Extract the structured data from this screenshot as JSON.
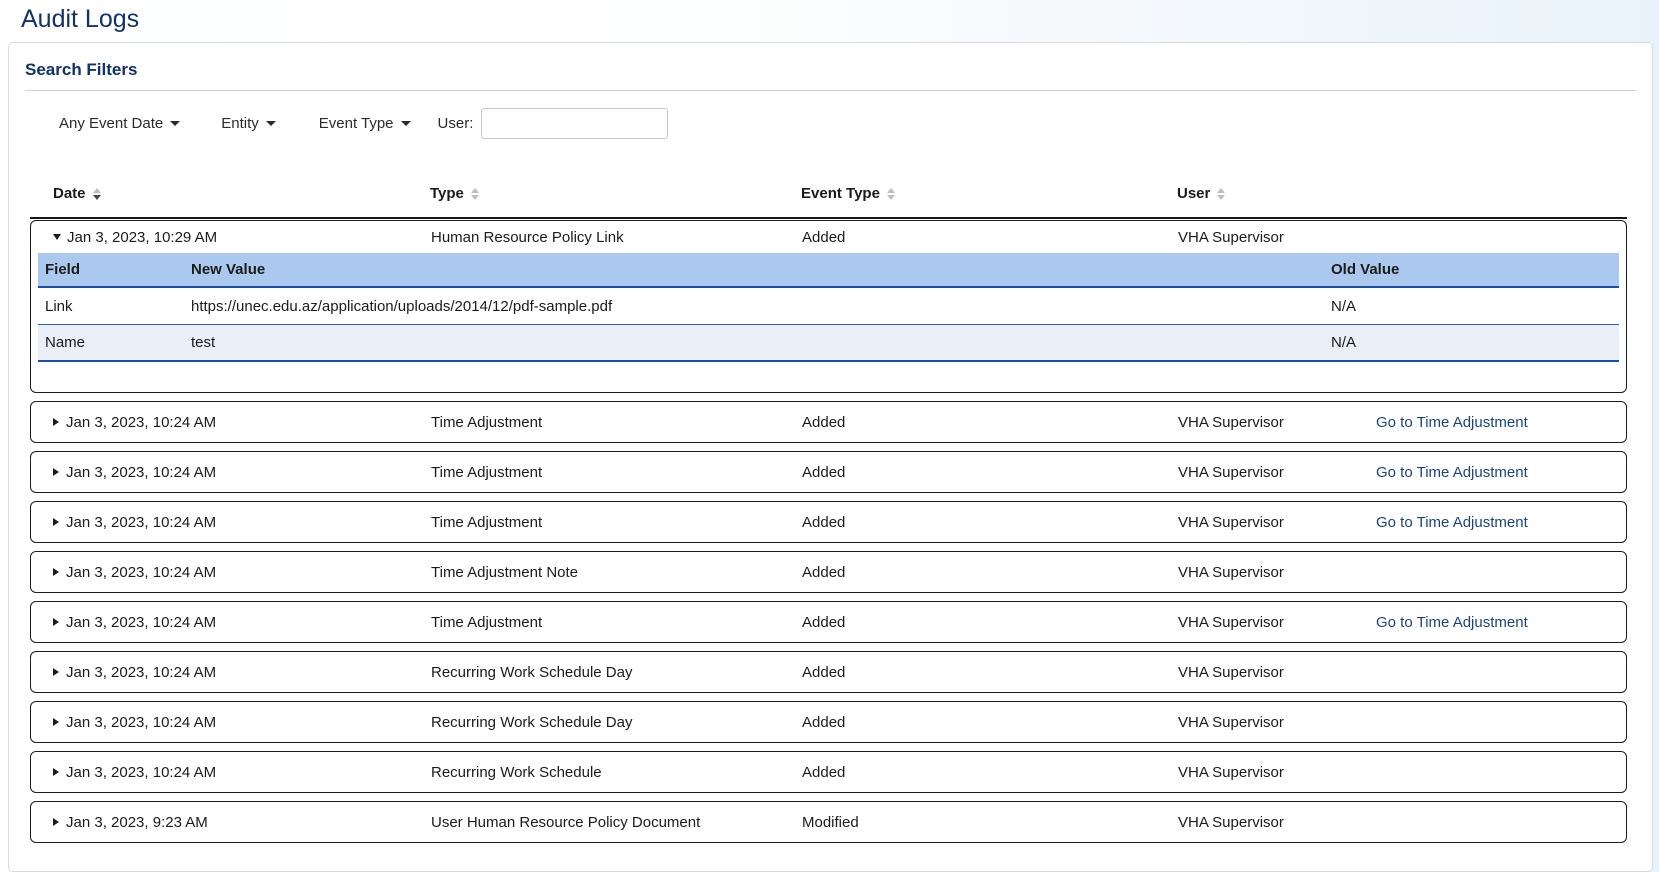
{
  "page": {
    "title": "Audit Logs"
  },
  "filters": {
    "heading": "Search Filters",
    "dropdowns": [
      {
        "label": "Any Event Date"
      },
      {
        "label": "Entity"
      },
      {
        "label": "Event Type"
      }
    ],
    "user": {
      "label": "User:",
      "value": "",
      "placeholder": ""
    }
  },
  "table": {
    "columns": [
      {
        "label": "Date",
        "sort_state": "desc"
      },
      {
        "label": "Type",
        "sort_state": "none"
      },
      {
        "label": "Event Type",
        "sort_state": "none"
      },
      {
        "label": "User",
        "sort_state": "none"
      }
    ],
    "rows": [
      {
        "date": "Jan 3, 2023, 10:29 AM",
        "type": "Human Resource Policy Link",
        "event_type": "Added",
        "user": "VHA Supervisor",
        "action": "",
        "expanded": true,
        "details": {
          "columns": [
            "Field",
            "New Value",
            "Old Value"
          ],
          "rows": [
            {
              "field": "Link",
              "new_value": "https://unec.edu.az/application/uploads/2014/12/pdf-sample.pdf",
              "old_value": "N/A"
            },
            {
              "field": "Name",
              "new_value": "test",
              "old_value": "N/A"
            }
          ]
        }
      },
      {
        "date": "Jan 3, 2023, 10:24 AM",
        "type": "Time Adjustment",
        "event_type": "Added",
        "user": "VHA Supervisor",
        "action": "Go to Time Adjustment",
        "expanded": false
      },
      {
        "date": "Jan 3, 2023, 10:24 AM",
        "type": "Time Adjustment",
        "event_type": "Added",
        "user": "VHA Supervisor",
        "action": "Go to Time Adjustment",
        "expanded": false
      },
      {
        "date": "Jan 3, 2023, 10:24 AM",
        "type": "Time Adjustment",
        "event_type": "Added",
        "user": "VHA Supervisor",
        "action": "Go to Time Adjustment",
        "expanded": false
      },
      {
        "date": "Jan 3, 2023, 10:24 AM",
        "type": "Time Adjustment Note",
        "event_type": "Added",
        "user": "VHA Supervisor",
        "action": "",
        "expanded": false
      },
      {
        "date": "Jan 3, 2023, 10:24 AM",
        "type": "Time Adjustment",
        "event_type": "Added",
        "user": "VHA Supervisor",
        "action": "Go to Time Adjustment",
        "expanded": false
      },
      {
        "date": "Jan 3, 2023, 10:24 AM",
        "type": "Recurring Work Schedule Day",
        "event_type": "Added",
        "user": "VHA Supervisor",
        "action": "",
        "expanded": false
      },
      {
        "date": "Jan 3, 2023, 10:24 AM",
        "type": "Recurring Work Schedule Day",
        "event_type": "Added",
        "user": "VHA Supervisor",
        "action": "",
        "expanded": false
      },
      {
        "date": "Jan 3, 2023, 10:24 AM",
        "type": "Recurring Work Schedule",
        "event_type": "Added",
        "user": "VHA Supervisor",
        "action": "",
        "expanded": false
      },
      {
        "date": "Jan 3, 2023, 9:23 AM",
        "type": "User Human Resource Policy Document",
        "event_type": "Modified",
        "user": "VHA Supervisor",
        "action": "",
        "expanded": false
      }
    ]
  },
  "colors": {
    "heading_navy": "#13316d",
    "link_blue": "#1a4480",
    "subtable_header_bg": "#abc8ee",
    "subtable_strong_border": "#1b4ea4",
    "subtable_row_border": "#2e5fae",
    "subtable_alt_row_bg": "#e9eef7",
    "card_border": "#1b1b1b",
    "panel_border": "#d5dbe1"
  }
}
